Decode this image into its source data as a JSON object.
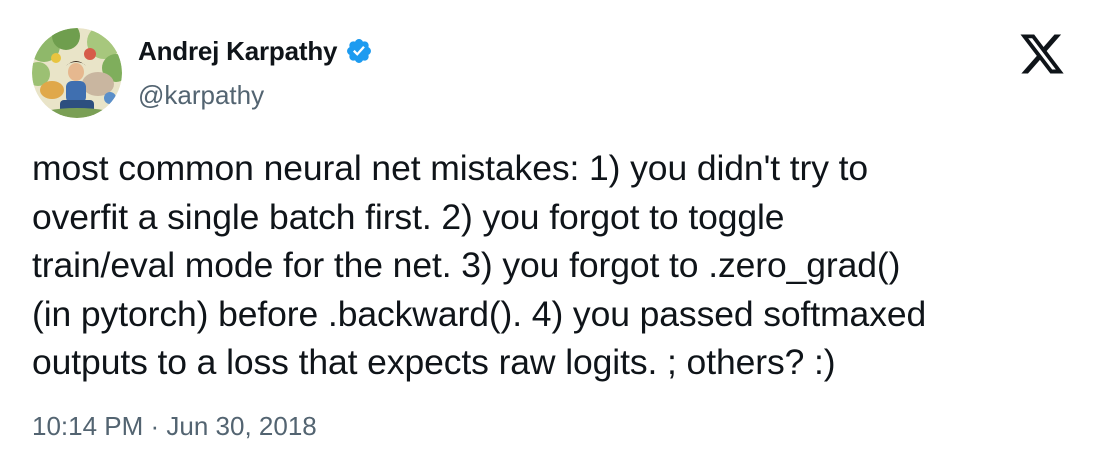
{
  "author": {
    "display_name": "Andrej Karpathy",
    "handle": "@karpathy",
    "verified": true,
    "avatar_icon": "illustrated-avatar-icon"
  },
  "platform": {
    "logo_icon": "x-logo-icon"
  },
  "tweet": {
    "text": "most common neural net mistakes: 1) you didn't try to\noverfit a single batch first. 2) you forgot to toggle\ntrain/eval mode for the net. 3) you forgot to .zero_grad()\n(in pytorch) before .backward(). 4) you passed softmaxed\noutputs to a loss that expects raw logits. ; others? :)",
    "timestamp": "10:14 PM · Jun 30, 2018"
  },
  "colors": {
    "text_primary": "#0f1419",
    "text_secondary": "#536471",
    "verified_blue": "#1d9bf0",
    "background": "#ffffff"
  }
}
